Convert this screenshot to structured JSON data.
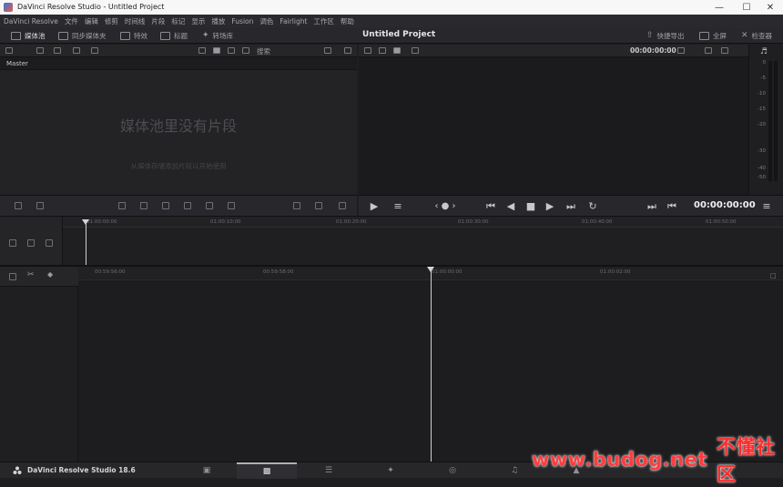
{
  "window": {
    "title": "DaVinci Resolve Studio - Untitled Project",
    "minimize_icon": "minimize-icon",
    "maximize_icon": "maximize-icon",
    "close_icon": "close-icon"
  },
  "menubar": {
    "items": [
      "DaVinci Resolve",
      "文件",
      "编辑",
      "修剪",
      "时间线",
      "片段",
      "标记",
      "显示",
      "播放",
      "Fusion",
      "调色",
      "Fairlight",
      "工作区",
      "帮助"
    ]
  },
  "toolbar": {
    "media_pool": "媒体池",
    "sync_bin": "同步媒体夹",
    "effects": "特效",
    "titles": "标题",
    "transitions": "转场库",
    "project_title": "Untitled Project",
    "quick_export": "快捷导出",
    "fullscreen": "全屏",
    "inspector": "检查器"
  },
  "media_pool": {
    "search_placeholder": "搜索",
    "master_bin": "Master",
    "empty_message": "媒体池里没有片段",
    "empty_hint": "从媒体存储添加片段以开始使用"
  },
  "viewer": {
    "source_timecode": "00:00:00:00",
    "main_timecode": "00:00:00:00"
  },
  "audio_meter": {
    "ticks": [
      "0",
      "-5",
      "-10",
      "-15",
      "-20",
      "-30",
      "-40",
      "-50"
    ]
  },
  "upper_timeline": {
    "ruler_labels": [
      "01:00:00:00",
      "01:00:10:00",
      "01:00:20:00",
      "01:00:30:00",
      "01:00:40:00",
      "01:00:50:00"
    ]
  },
  "lower_timeline": {
    "ruler_labels": [
      "00:59:56:00",
      "00:59:58:00",
      "01:00:00:00",
      "01:00:02:00"
    ]
  },
  "statusbar": {
    "app_name": "DaVinci Resolve Studio 18.6",
    "pages": [
      "media-page-icon",
      "cut-page-icon",
      "edit-page-icon",
      "fusion-page-icon",
      "color-page-icon",
      "fairlight-page-icon",
      "deliver-page-icon"
    ],
    "active_page": "cut-page-icon"
  },
  "watermark": {
    "url": "www.budog.net",
    "text": "不懂社区"
  },
  "colors": {
    "background": "#1e1e21",
    "accent": "#ff3d3d"
  }
}
